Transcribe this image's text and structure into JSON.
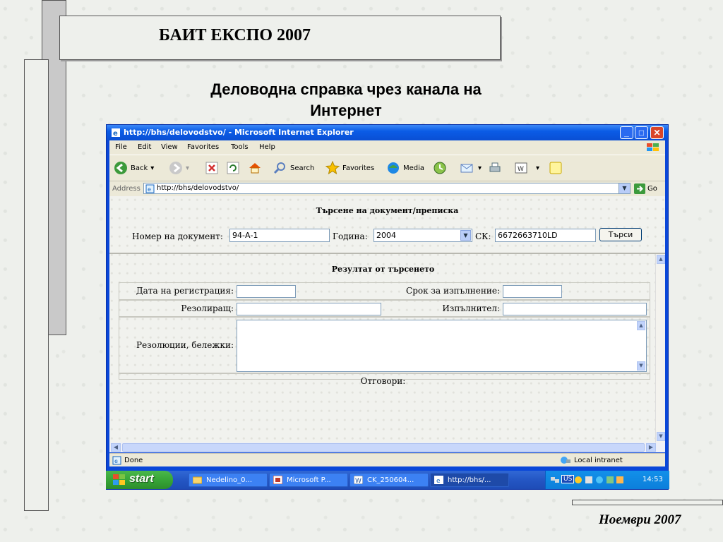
{
  "slide": {
    "title": "БАИТ ЕКСПО 2007",
    "subtitle_line1": "Деловодна справка чрез канала на",
    "subtitle_line2": "Интернет",
    "date": "Ноември 2007"
  },
  "window": {
    "title": "http://bhs/delovodstvo/ - Microsoft Internet Explorer",
    "menu": [
      "File",
      "Edit",
      "View",
      "Favorites",
      "Tools",
      "Help"
    ],
    "toolbar": {
      "back": "Back",
      "search": "Search",
      "favorites": "Favorites",
      "media": "Media"
    },
    "address_label": "Address",
    "address_value": "http://bhs/delovodstvo/",
    "go": "Go",
    "status_left": "Done",
    "status_zone": "Local intranet"
  },
  "search_form": {
    "title": "Търсене на документ/преписка",
    "doc_number_label": "Номер на документ:",
    "doc_number_value": "94-А-1",
    "year_label": "Година:",
    "year_value": "2004",
    "sk_label": "СК:",
    "sk_value": "6672663710LD",
    "search_button": "Търси"
  },
  "results": {
    "title": "Резултат от търсенето",
    "reg_date_label": "Дата на регистрация:",
    "deadline_label": "Срок за изпълнение:",
    "resolver_label": "Резолиращ:",
    "executor_label": "Изпълнител:",
    "resolutions_label": "Резолюции, бележки:",
    "answers_label": "Отговори:"
  },
  "taskbar": {
    "start": "start",
    "tasks": [
      "Nedelino_0...",
      "Microsoft P...",
      "CK_250604...",
      "http://bhs/..."
    ],
    "lang": "US",
    "clock": "14:53"
  },
  "colors": {
    "xp_blue": "#0a47d8",
    "start_green": "#37a637",
    "tray_blue": "#0c7fdb"
  }
}
